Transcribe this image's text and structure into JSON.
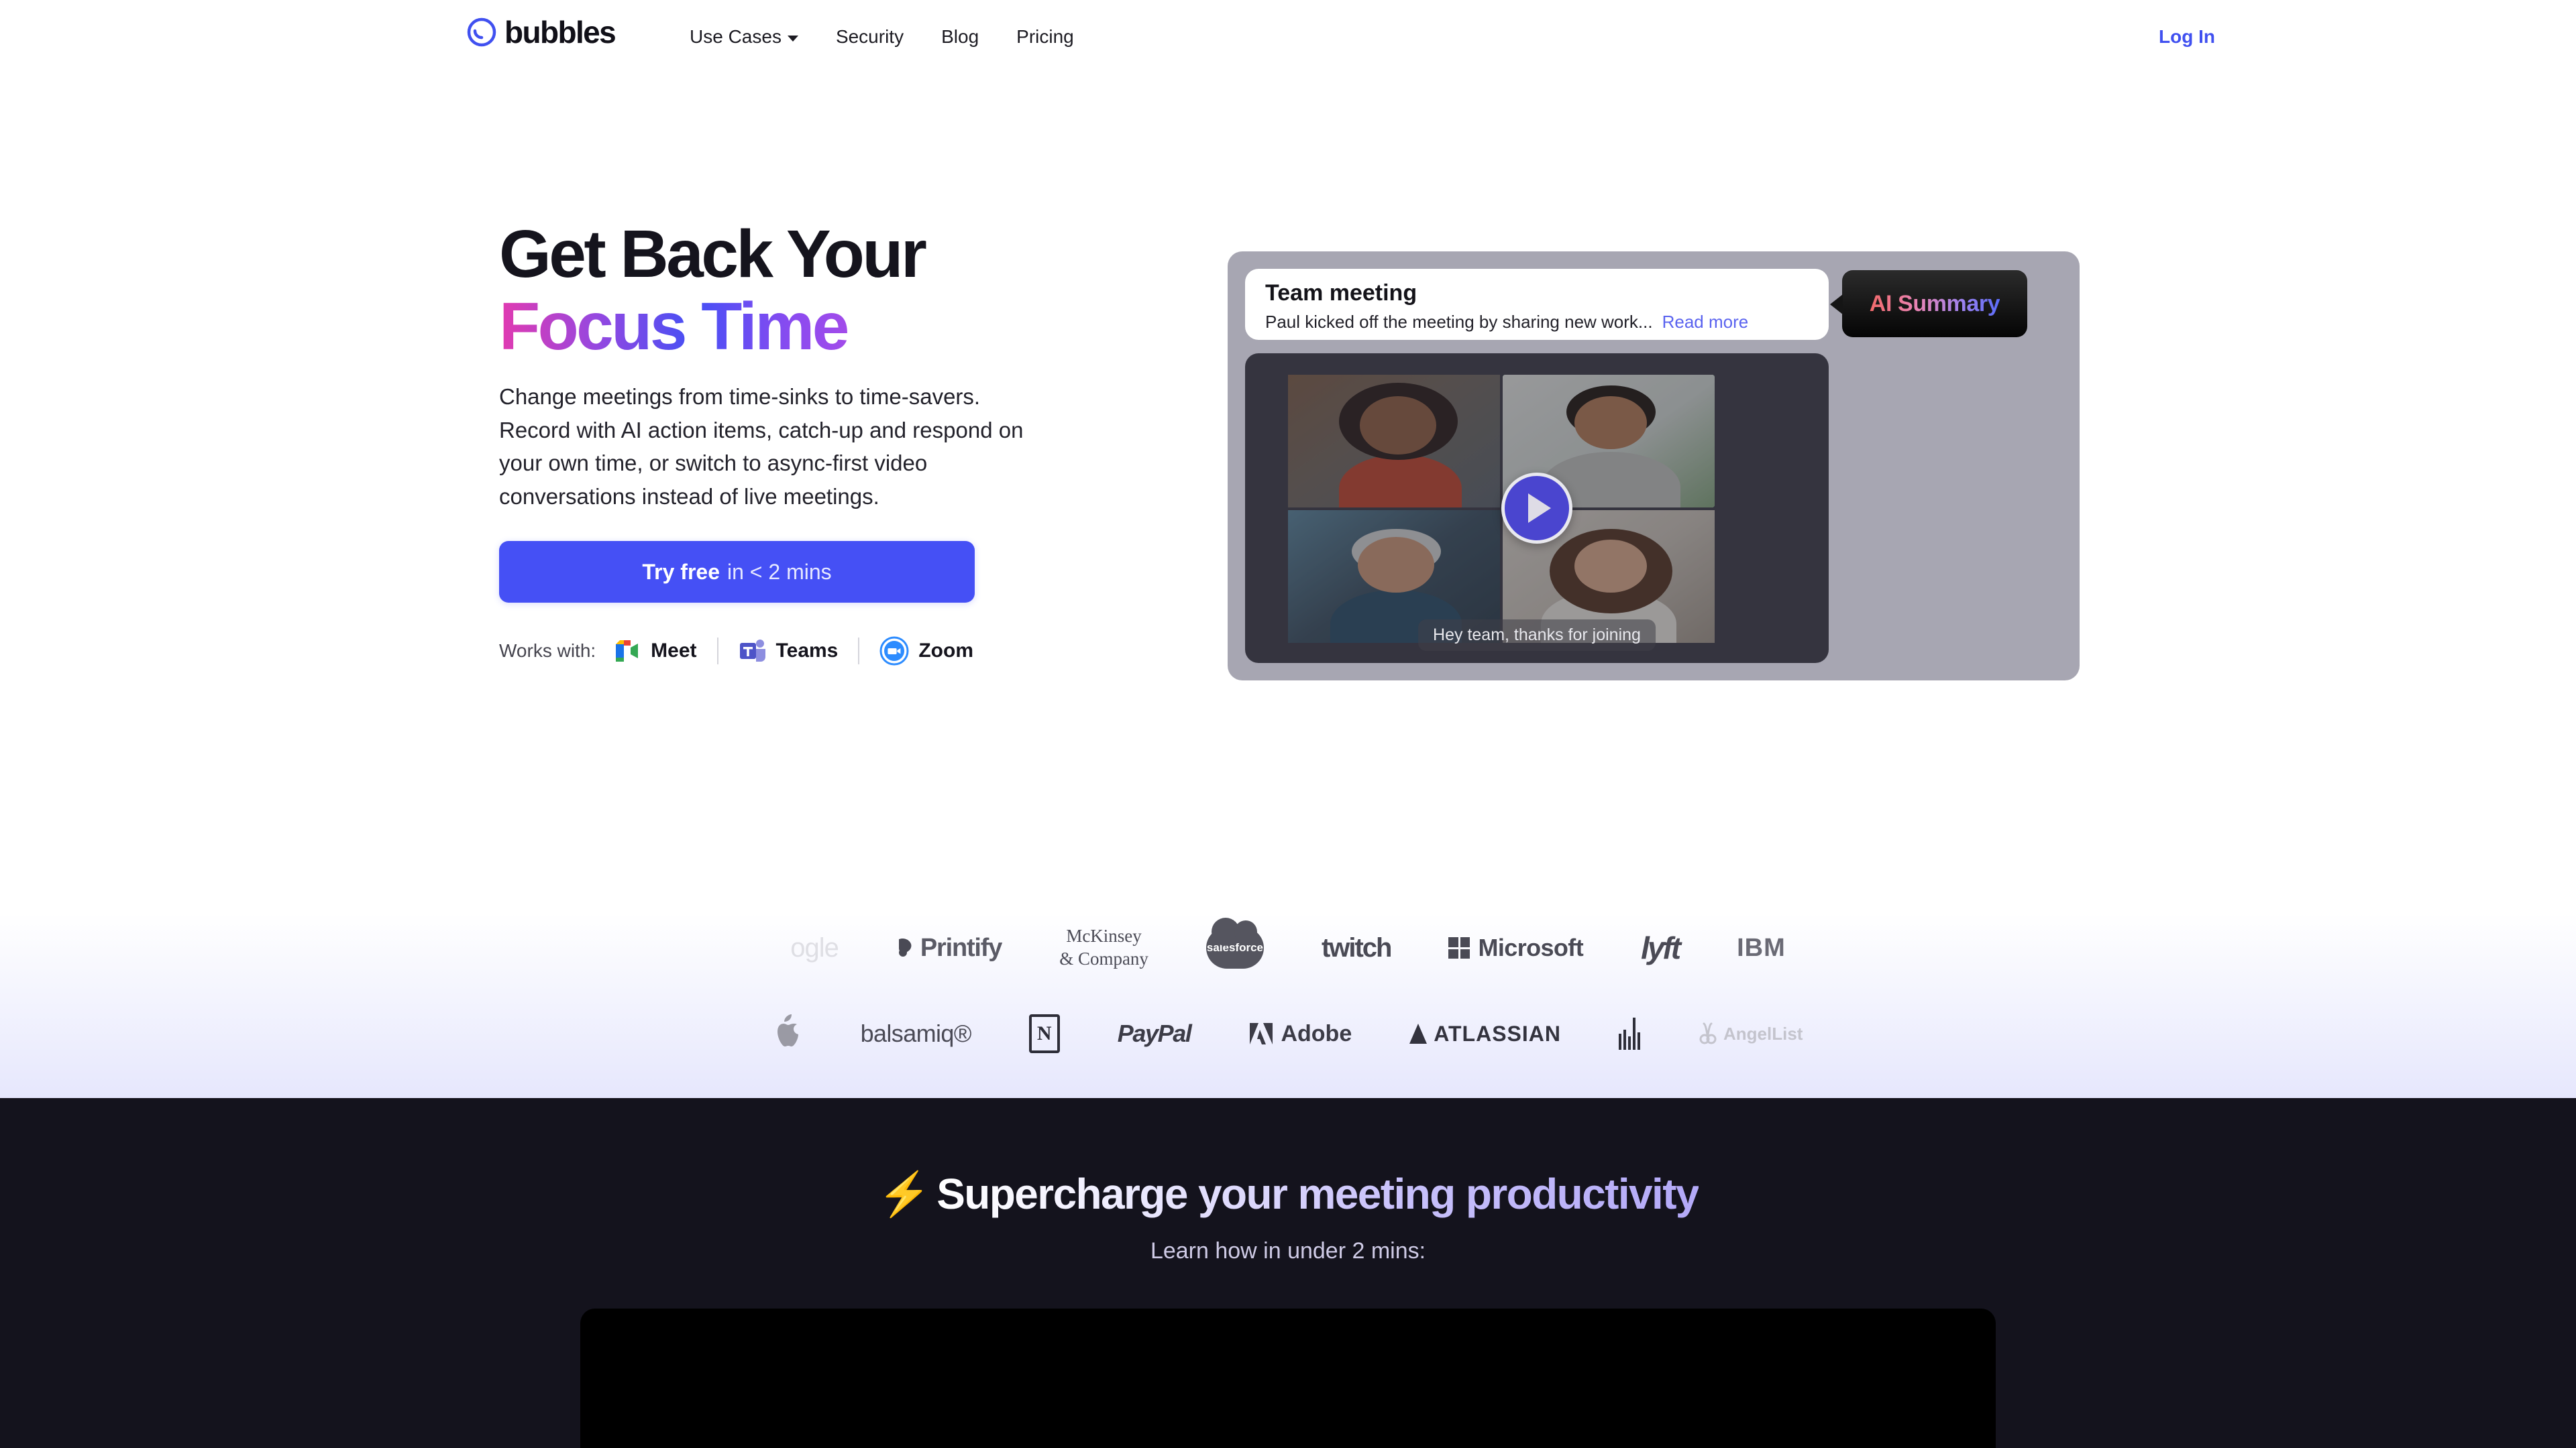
{
  "header": {
    "brand": {
      "word": "bubbles",
      "mark_icon": "bubbles-logo-icon"
    },
    "nav": [
      {
        "label": "Use Cases",
        "has_dropdown": true
      },
      {
        "label": "Security",
        "has_dropdown": false
      },
      {
        "label": "Blog",
        "has_dropdown": false
      },
      {
        "label": "Pricing",
        "has_dropdown": false
      }
    ],
    "login_label": "Log In",
    "login_color": "#4050f0"
  },
  "hero": {
    "title_line1": "Get Back Your",
    "title_line2": "Focus Time",
    "title_gradient": [
      "#e23ab0",
      "#9548e0",
      "#4550f5",
      "#8a4bf0",
      "#a24bea"
    ],
    "subtitle": "Change meetings from time-sinks to time-savers. Record with AI action items, catch-up and respond on your own time, or switch to async-first video conversations instead of live meetings.",
    "cta": {
      "strong_label": "Try free",
      "light_label": "in < 2 mins",
      "bg_color": "#4550f5"
    },
    "works_with": {
      "label": "Works with:",
      "items": [
        {
          "name": "Meet",
          "icon": "google-meet-icon"
        },
        {
          "name": "Teams",
          "icon": "microsoft-teams-icon"
        },
        {
          "name": "Zoom",
          "icon": "zoom-icon"
        }
      ]
    },
    "player": {
      "meeting_title": "Team meeting",
      "meeting_summary": "Paul kicked off the meeting by sharing new work...",
      "read_more_label": "Read more",
      "ai_badge_label": "AI Summary",
      "ai_badge_gradient": [
        "#f26a6a",
        "#e885b8",
        "#9b82f0",
        "#5b6cf8"
      ],
      "play_button_icon": "play-icon",
      "caption": "Hey team, thanks for joining",
      "participants": [
        {
          "position": "top-left",
          "speaking": false
        },
        {
          "position": "top-right",
          "speaking": true
        },
        {
          "position": "bottom-left",
          "speaking": false
        },
        {
          "position": "bottom-right",
          "speaking": false
        }
      ]
    }
  },
  "logo_wall": {
    "row1": [
      {
        "name": "Google",
        "text": "ogle"
      },
      {
        "name": "Printify",
        "text": "Printify"
      },
      {
        "name": "McKinsey & Company",
        "line1": "McKinsey",
        "line2": "& Company"
      },
      {
        "name": "Salesforce",
        "text": "salesforce"
      },
      {
        "name": "Twitch",
        "text": "twitch"
      },
      {
        "name": "Microsoft",
        "text": "Microsoft"
      },
      {
        "name": "Lyft",
        "text": "lyft"
      },
      {
        "name": "IBM",
        "text": "IBM"
      }
    ],
    "row2": [
      {
        "name": "Apple",
        "text": ""
      },
      {
        "name": "Balsamiq",
        "text": "balsamiq®"
      },
      {
        "name": "Notion",
        "text": "N"
      },
      {
        "name": "PayPal",
        "text": "PayPal"
      },
      {
        "name": "Adobe",
        "text": "Adobe"
      },
      {
        "name": "Atlassian",
        "text": "ATLASSIAN"
      },
      {
        "name": "HP",
        "text": ""
      },
      {
        "name": "AngelList",
        "text": "AngelList"
      }
    ]
  },
  "supercharge": {
    "bolt": "⚡",
    "title": "Supercharge your meeting productivity",
    "subtitle": "Learn how in under 2 mins:",
    "bg_color": "#14131d"
  }
}
